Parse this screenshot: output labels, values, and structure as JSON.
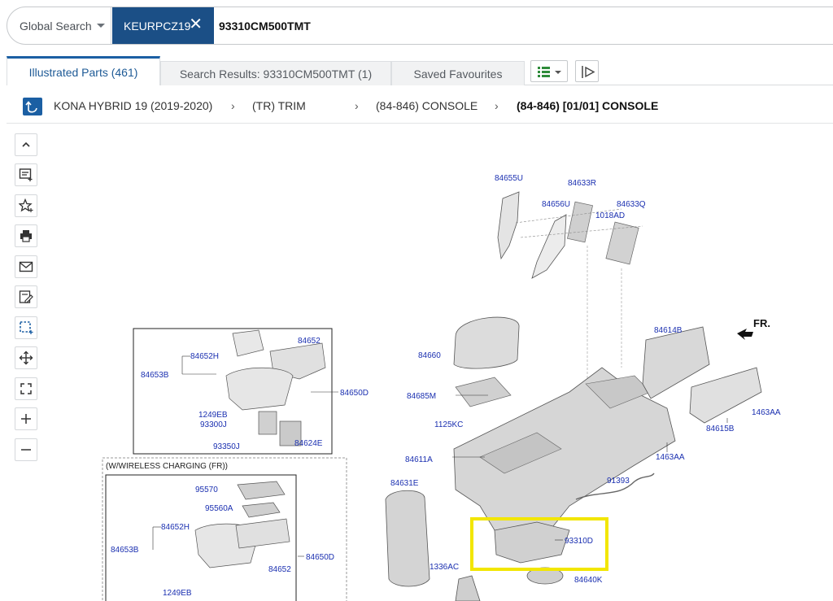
{
  "search": {
    "scope": "Global Search",
    "chip": "KEURPCZ19",
    "query": "93310CM500TMT"
  },
  "tabs": [
    {
      "label": "Illustrated Parts (461)"
    },
    {
      "label": "Search Results: 93310CM500TMT (1)"
    },
    {
      "label": "Saved Favourites"
    }
  ],
  "breadcrumb": [
    "KONA HYBRID 19 (2019-2020)",
    "(TR) TRIM",
    "(84-846) CONSOLE",
    "(84-846) [01/01] CONSOLE"
  ],
  "diagram": {
    "direction_label": "FR.",
    "wireless_label": "(W/WIRELESS CHARGING (FR))",
    "highlight_color": "#f2e600",
    "parts": {
      "p84655u": "84655U",
      "p84633r": "84633R",
      "p84656u": "84656U",
      "p84633q": "84633Q",
      "p1018ad": "1018AD",
      "p84614b": "84614B",
      "p84652_a": "84652",
      "p84652h_a": "84652H",
      "p84653b_a": "84653B",
      "p84650d_a": "84650D",
      "p1249eb_a": "1249EB",
      "p93300j": "93300J",
      "p84624e": "84624E",
      "p93350j": "93350J",
      "p84660": "84660",
      "p84685m": "84685M",
      "p1125kc": "1125KC",
      "p84611a": "84611A",
      "p84615b": "84615B",
      "p1463aa_a": "1463AA",
      "p1463aa_b": "1463AA",
      "p91393": "91393",
      "p84631e": "84631E",
      "p93310d": "93310D",
      "p1336ac": "1336AC",
      "p84640k": "84640K",
      "p95570": "95570",
      "p95560a": "95560A",
      "p84652h_b": "84652H",
      "p84653b_b": "84653B",
      "p84650d_b": "84650D",
      "p84652_b": "84652",
      "p1249eb_b": "1249EB"
    }
  },
  "icons": {
    "home": "breadcrumb-home-icon",
    "list_view": "list-view-icon",
    "collapse": "collapse-panel-icon"
  }
}
